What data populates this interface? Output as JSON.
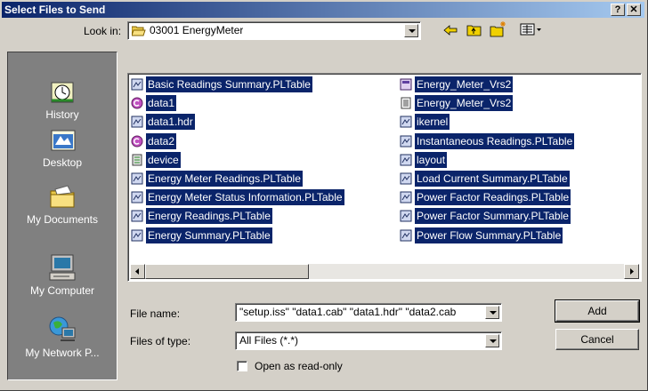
{
  "window": {
    "title": "Select Files to Send",
    "help_label": "?",
    "close_label": "✕"
  },
  "look_in": {
    "label": "Look in:",
    "value": "03001 EnergyMeter"
  },
  "places": [
    {
      "label": "History",
      "icon": "history-icon"
    },
    {
      "label": "Desktop",
      "icon": "desktop-icon"
    },
    {
      "label": "My Documents",
      "icon": "my-documents-icon"
    },
    {
      "label": "My Computer",
      "icon": "my-computer-icon"
    },
    {
      "label": "My Network P...",
      "icon": "my-network-places-icon"
    }
  ],
  "files_col1": [
    {
      "name": "Basic Readings Summary.PLTable",
      "icon": "pltable-file-icon"
    },
    {
      "name": "data1",
      "icon": "cab-file-icon"
    },
    {
      "name": "data1.hdr",
      "icon": "pltable-file-icon"
    },
    {
      "name": "data2",
      "icon": "cab-file-icon"
    },
    {
      "name": "device",
      "icon": "config-file-icon"
    },
    {
      "name": "Energy Meter Readings.PLTable",
      "icon": "pltable-file-icon"
    },
    {
      "name": "Energy Meter Status Information.PLTable",
      "icon": "pltable-file-icon"
    },
    {
      "name": "Energy Readings.PLTable",
      "icon": "pltable-file-icon"
    },
    {
      "name": "Energy Summary.PLTable",
      "icon": "pltable-file-icon"
    }
  ],
  "files_col2": [
    {
      "name": "Energy_Meter_Vrs2",
      "icon": "project-file-icon"
    },
    {
      "name": "Energy_Meter_Vrs2",
      "icon": "text-file-icon"
    },
    {
      "name": "ikernel",
      "icon": "pltable-file-icon"
    },
    {
      "name": "Instantaneous Readings.PLTable",
      "icon": "pltable-file-icon"
    },
    {
      "name": "layout",
      "icon": "pltable-file-icon"
    },
    {
      "name": "Load Current Summary.PLTable",
      "icon": "pltable-file-icon"
    },
    {
      "name": "Power Factor Readings.PLTable",
      "icon": "pltable-file-icon"
    },
    {
      "name": "Power Factor Summary.PLTable",
      "icon": "pltable-file-icon"
    },
    {
      "name": "Power Flow Summary.PLTable",
      "icon": "pltable-file-icon"
    }
  ],
  "file_name": {
    "label": "File name:",
    "value": "\"setup.iss\" \"data1.cab\" \"data1.hdr\" \"data2.cab"
  },
  "file_type": {
    "label": "Files of type:",
    "value": "All Files  (*.*)"
  },
  "readonly": {
    "label": "Open as read-only"
  },
  "buttons": {
    "add": "Add",
    "cancel": "Cancel"
  },
  "colors": {
    "selection": "#0a246a",
    "face": "#d4d0c8",
    "places_bg": "#808080"
  }
}
